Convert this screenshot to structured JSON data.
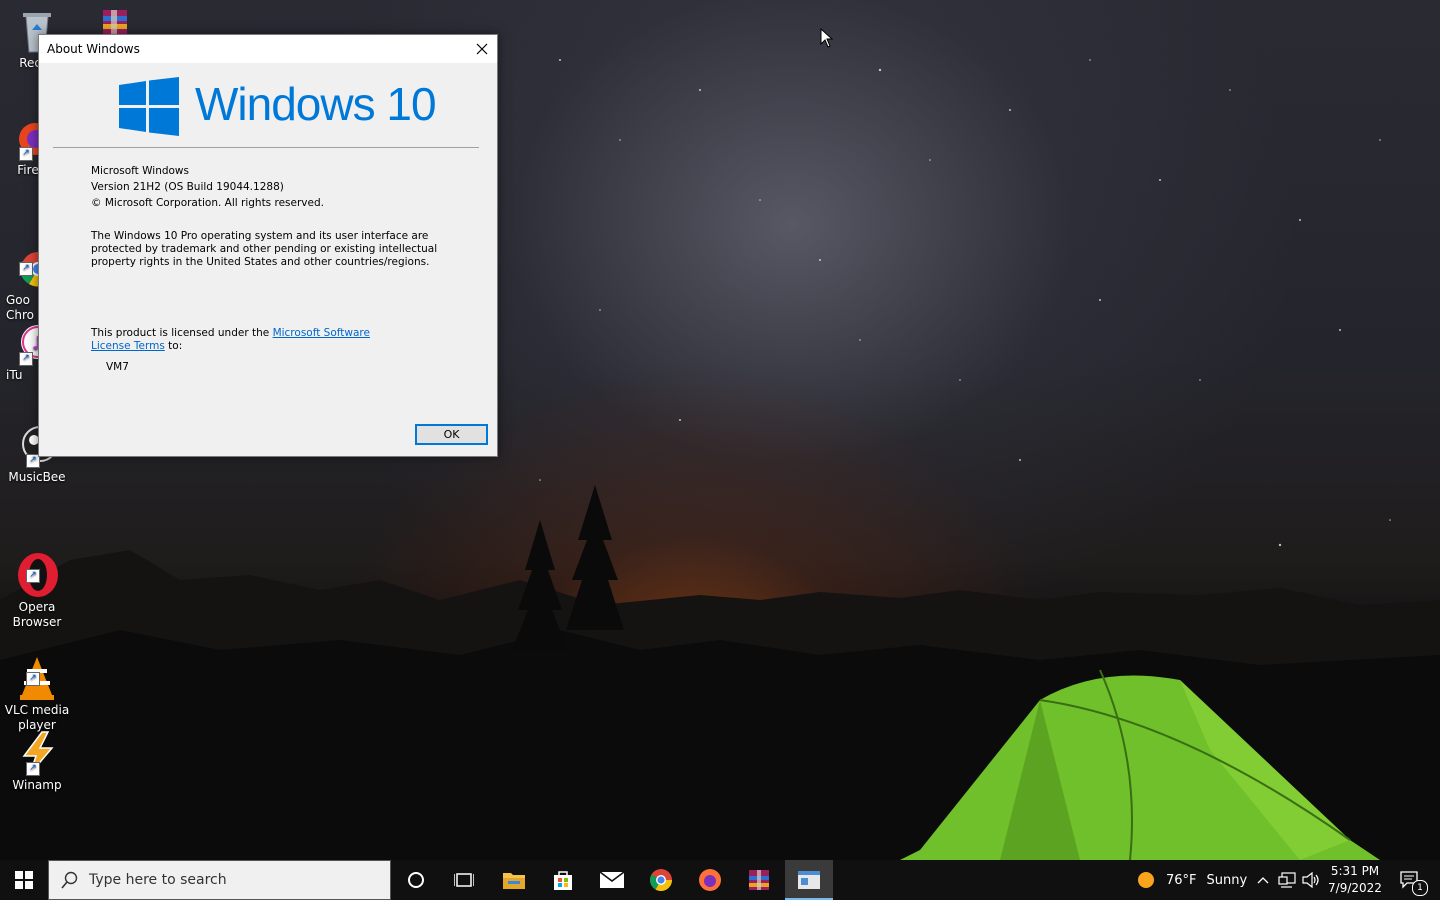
{
  "desktop": {
    "icons": [
      {
        "label": "Recyc",
        "icon": "recycle-bin-icon"
      },
      {
        "label": "",
        "icon": "winrar-icon"
      },
      {
        "label": "Fire",
        "icon": "firefox-icon"
      },
      {
        "label": "Goo\nChro",
        "icon": "chrome-icon"
      },
      {
        "label": "iTu",
        "icon": "itunes-icon"
      },
      {
        "label": "MusicBee",
        "icon": "musicbee-icon"
      },
      {
        "label": "Opera\nBrowser",
        "icon": "opera-icon"
      },
      {
        "label": "VLC media\nplayer",
        "icon": "vlc-icon"
      },
      {
        "label": "Winamp",
        "icon": "winamp-icon"
      }
    ]
  },
  "dialog": {
    "title": "About Windows",
    "logo_text": "Windows 10",
    "product": "Microsoft Windows",
    "version": "Version 21H2 (OS Build 19044.1288)",
    "copyright": "© Microsoft Corporation. All rights reserved.",
    "description": "The Windows 10 Pro operating system and its user interface are protected by trademark and other pending or existing intellectual property rights in the United States and other countries/regions.",
    "license_prefix": "This product is licensed under the ",
    "license_link": "Microsoft Software License Terms",
    "license_suffix": " to:",
    "licensee": "VM7",
    "ok_label": "OK"
  },
  "taskbar": {
    "search_placeholder": "Type here to search",
    "weather_temp": "76°F",
    "weather_desc": "Sunny",
    "time": "5:31 PM",
    "date": "7/9/2022",
    "notification_count": "1",
    "apps": [
      "cortana-icon",
      "task-view-icon",
      "file-explorer-icon",
      "store-icon",
      "mail-icon",
      "chrome-icon",
      "firefox-icon",
      "winrar-icon",
      "about-windows-icon"
    ]
  },
  "colors": {
    "accent": "#0078d7",
    "link": "#0066cc",
    "taskbar": "#101010"
  }
}
